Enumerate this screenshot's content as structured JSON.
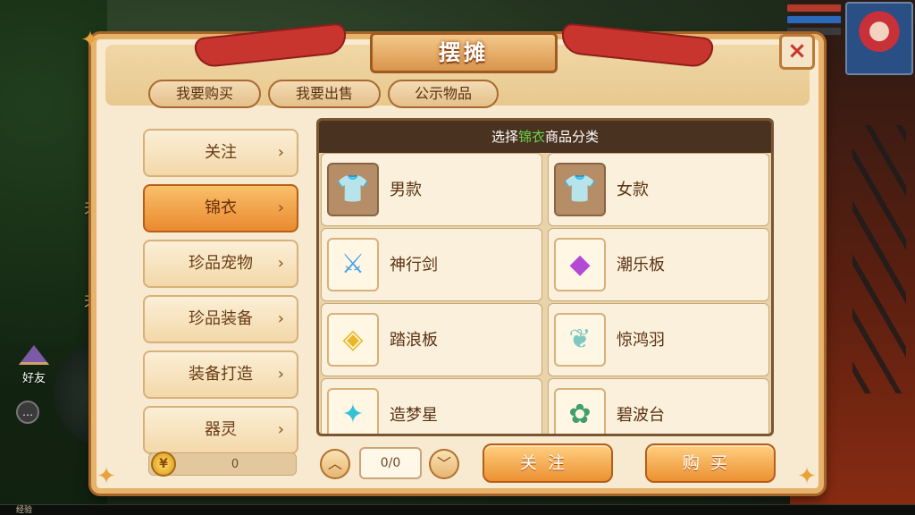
{
  "background": {
    "hud_text_1": "天罡",
    "hud_text_2": "天罡",
    "friend_label": "好友",
    "chat_icon": "chat-bubble-icon",
    "exp_label": "经验"
  },
  "panel": {
    "title": "摆摊",
    "close_icon": "×",
    "tabs": [
      {
        "label": "我要购买"
      },
      {
        "label": "我要出售"
      },
      {
        "label": "公示物品"
      }
    ],
    "categories": [
      {
        "label": "关注",
        "active": false
      },
      {
        "label": "锦衣",
        "active": true
      },
      {
        "label": "珍品宠物",
        "active": false
      },
      {
        "label": "珍品装备",
        "active": false
      },
      {
        "label": "装备打造",
        "active": false
      },
      {
        "label": "器灵",
        "active": false
      }
    ],
    "category_chevron": "›",
    "grid_header": {
      "prefix": "选择",
      "highlight": "锦衣",
      "suffix": "商品分类"
    },
    "items": [
      {
        "name": "男款",
        "icon": "clothing-icon"
      },
      {
        "name": "女款",
        "icon": "clothing-icon"
      },
      {
        "name": "神行剑",
        "icon": "sword-icon"
      },
      {
        "name": "潮乐板",
        "icon": "board-icon"
      },
      {
        "name": "踏浪板",
        "icon": "board-icon"
      },
      {
        "name": "惊鸿羽",
        "icon": "feather-icon"
      },
      {
        "name": "造梦星",
        "icon": "star-icon"
      },
      {
        "name": "碧波台",
        "icon": "lotus-icon"
      }
    ],
    "coin_value": "0",
    "page_indicator": "0/0",
    "up_arrow": "︿",
    "down_arrow": "﹀",
    "follow_button": "关注",
    "buy_button": "购买"
  },
  "colors": {
    "highlight_green": "#66d44c",
    "active_category": "#e98a2f",
    "panel_bg": "#f7ead0"
  }
}
